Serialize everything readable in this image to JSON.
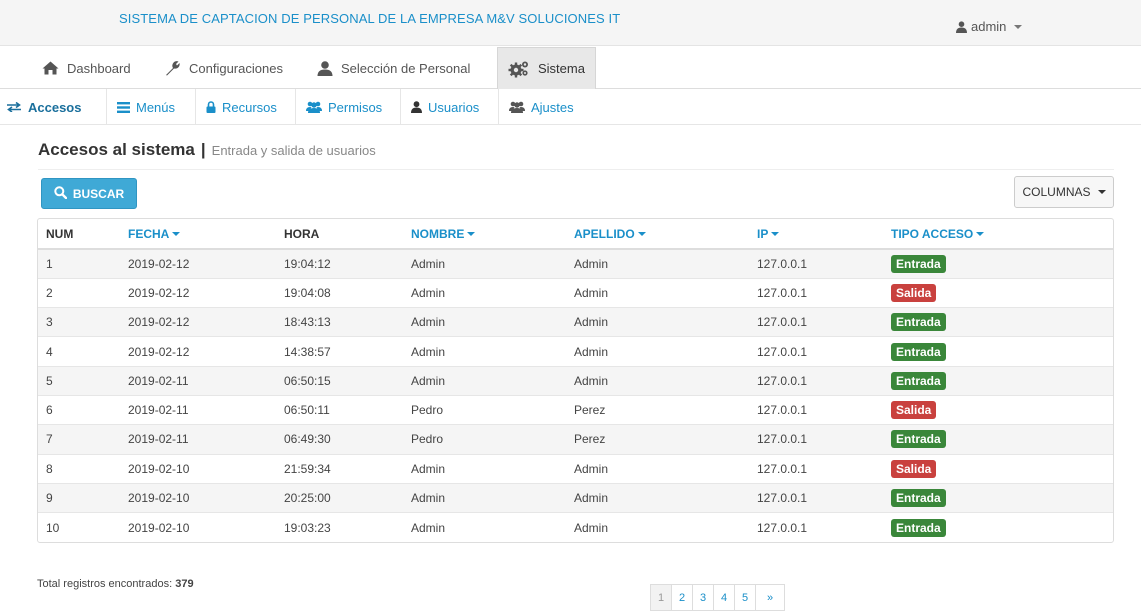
{
  "header": {
    "app_title": "SISTEMA DE CAPTACION DE PERSONAL DE LA EMPRESA M&V SOLUCIONES IT",
    "user_name": "admin"
  },
  "main_nav": [
    {
      "label": "Dashboard",
      "icon": "home-icon"
    },
    {
      "label": "Configuraciones",
      "icon": "wrench-icon"
    },
    {
      "label": "Selección de Personal",
      "icon": "user-icon"
    },
    {
      "label": "Sistema",
      "icon": "gears-icon",
      "active": true
    }
  ],
  "sub_nav": [
    {
      "label": "Accesos",
      "icon": "exchange-icon",
      "active": true
    },
    {
      "label": "Menús",
      "icon": "list-icon"
    },
    {
      "label": "Recursos",
      "icon": "lock-icon"
    },
    {
      "label": "Permisos",
      "icon": "users-icon"
    },
    {
      "label": "Usuarios",
      "icon": "user-icon"
    },
    {
      "label": "Ajustes",
      "icon": "users-icon"
    }
  ],
  "page": {
    "title": "Accesos al sistema",
    "separator": "|",
    "subtitle": "Entrada y salida de usuarios"
  },
  "toolbar": {
    "search_label": "BUSCAR",
    "columns_label": "COLUMNAS"
  },
  "table": {
    "columns": [
      {
        "label": "NUM",
        "sortable": false
      },
      {
        "label": "FECHA",
        "sortable": true
      },
      {
        "label": "HORA",
        "sortable": false
      },
      {
        "label": "NOMBRE",
        "sortable": true
      },
      {
        "label": "APELLIDO",
        "sortable": true
      },
      {
        "label": "IP",
        "sortable": true
      },
      {
        "label": "TIPO ACCESO",
        "sortable": true
      }
    ],
    "rows": [
      {
        "num": "1",
        "fecha": "2019-02-12",
        "hora": "19:04:12",
        "nombre": "Admin",
        "apellido": "Admin",
        "ip": "127.0.0.1",
        "tipo": "Entrada"
      },
      {
        "num": "2",
        "fecha": "2019-02-12",
        "hora": "19:04:08",
        "nombre": "Admin",
        "apellido": "Admin",
        "ip": "127.0.0.1",
        "tipo": "Salida"
      },
      {
        "num": "3",
        "fecha": "2019-02-12",
        "hora": "18:43:13",
        "nombre": "Admin",
        "apellido": "Admin",
        "ip": "127.0.0.1",
        "tipo": "Entrada"
      },
      {
        "num": "4",
        "fecha": "2019-02-12",
        "hora": "14:38:57",
        "nombre": "Admin",
        "apellido": "Admin",
        "ip": "127.0.0.1",
        "tipo": "Entrada"
      },
      {
        "num": "5",
        "fecha": "2019-02-11",
        "hora": "06:50:15",
        "nombre": "Admin",
        "apellido": "Admin",
        "ip": "127.0.0.1",
        "tipo": "Entrada"
      },
      {
        "num": "6",
        "fecha": "2019-02-11",
        "hora": "06:50:11",
        "nombre": "Pedro",
        "apellido": "Perez",
        "ip": "127.0.0.1",
        "tipo": "Salida"
      },
      {
        "num": "7",
        "fecha": "2019-02-11",
        "hora": "06:49:30",
        "nombre": "Pedro",
        "apellido": "Perez",
        "ip": "127.0.0.1",
        "tipo": "Entrada"
      },
      {
        "num": "8",
        "fecha": "2019-02-10",
        "hora": "21:59:34",
        "nombre": "Admin",
        "apellido": "Admin",
        "ip": "127.0.0.1",
        "tipo": "Salida"
      },
      {
        "num": "9",
        "fecha": "2019-02-10",
        "hora": "20:25:00",
        "nombre": "Admin",
        "apellido": "Admin",
        "ip": "127.0.0.1",
        "tipo": "Entrada"
      },
      {
        "num": "10",
        "fecha": "2019-02-10",
        "hora": "19:03:23",
        "nombre": "Admin",
        "apellido": "Admin",
        "ip": "127.0.0.1",
        "tipo": "Entrada"
      }
    ]
  },
  "badge_colors": {
    "Entrada": "#3a873a",
    "Salida": "#c9413e"
  },
  "footer": {
    "total_label": "Total registros encontrados:",
    "total_count": "379"
  },
  "pagination": {
    "pages": [
      "1",
      "2",
      "3",
      "4",
      "5"
    ],
    "current": "1",
    "next_label": "»"
  }
}
